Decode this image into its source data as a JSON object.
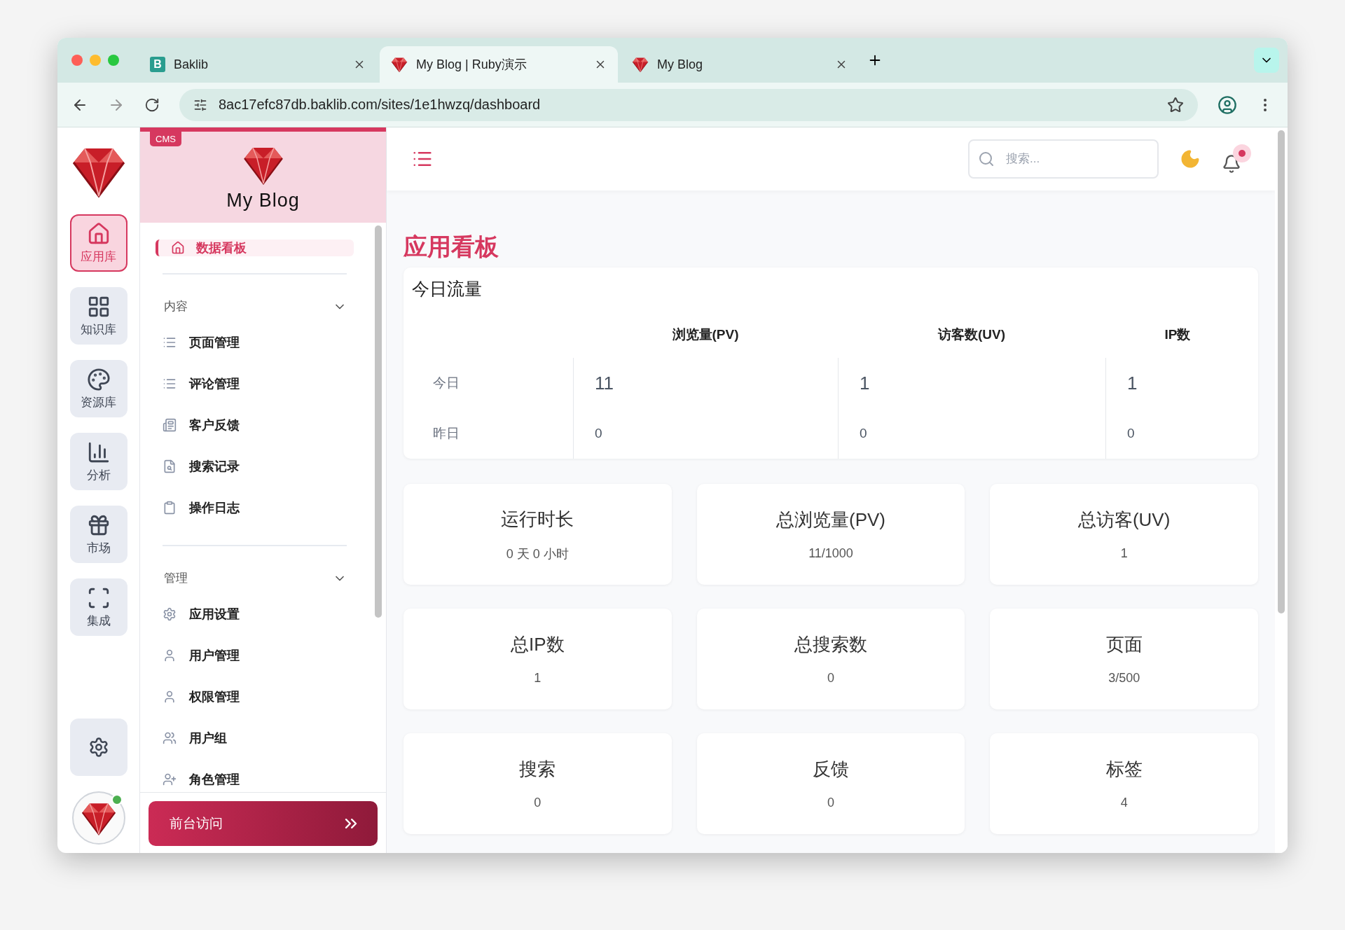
{
  "browser": {
    "tabs": [
      {
        "title": "Baklib",
        "selected": false,
        "kind": "letter",
        "letter": "B"
      },
      {
        "title": "My Blog | Ruby演示",
        "selected": true,
        "kind": "gem"
      },
      {
        "title": "My Blog",
        "selected": false,
        "kind": "gem"
      }
    ],
    "url": "8ac17efc87db.baklib.com/sites/1e1hwzq/dashboard"
  },
  "rail": {
    "items": [
      {
        "label": "应用库",
        "selected": true
      },
      {
        "label": "知识库",
        "selected": false
      },
      {
        "label": "资源库",
        "selected": false
      },
      {
        "label": "分析",
        "selected": false
      },
      {
        "label": "市场",
        "selected": false
      },
      {
        "label": "集成",
        "selected": false
      }
    ],
    "online": true
  },
  "sidebar": {
    "badge": "CMS",
    "title": "My Blog",
    "nav": [
      {
        "label": "数据看板",
        "selected": true
      }
    ],
    "sections": [
      {
        "title": "内容",
        "expanded": true,
        "items": [
          "页面管理",
          "评论管理",
          "客户反馈",
          "搜索记录",
          "操作日志"
        ]
      },
      {
        "title": "管理",
        "expanded": true,
        "items": [
          "应用设置",
          "用户管理",
          "权限管理",
          "用户组",
          "角色管理"
        ]
      }
    ],
    "visit_button": "前台访问"
  },
  "header": {
    "search_placeholder": "搜索...",
    "has_notification": true
  },
  "page_title": "应用看板",
  "traffic": {
    "title": "今日流量",
    "columns": [
      "浏览量(PV)",
      "访客数(UV)",
      "IP数"
    ],
    "rows": [
      {
        "label": "今日",
        "values": [
          "11",
          "1",
          "1"
        ],
        "emphasis": true
      },
      {
        "label": "昨日",
        "values": [
          "0",
          "0",
          "0"
        ],
        "emphasis": false
      }
    ]
  },
  "stats": [
    {
      "title": "运行时长",
      "value": "0 天 0 小时"
    },
    {
      "title": "总浏览量(PV)",
      "value": "11/1000"
    },
    {
      "title": "总访客(UV)",
      "value": "1"
    },
    {
      "title": "总IP数",
      "value": "1"
    },
    {
      "title": "总搜索数",
      "value": "0"
    },
    {
      "title": "页面",
      "value": "3/500"
    },
    {
      "title": "搜索",
      "value": "0"
    },
    {
      "title": "反馈",
      "value": "0"
    },
    {
      "title": "标签",
      "value": "4"
    }
  ]
}
